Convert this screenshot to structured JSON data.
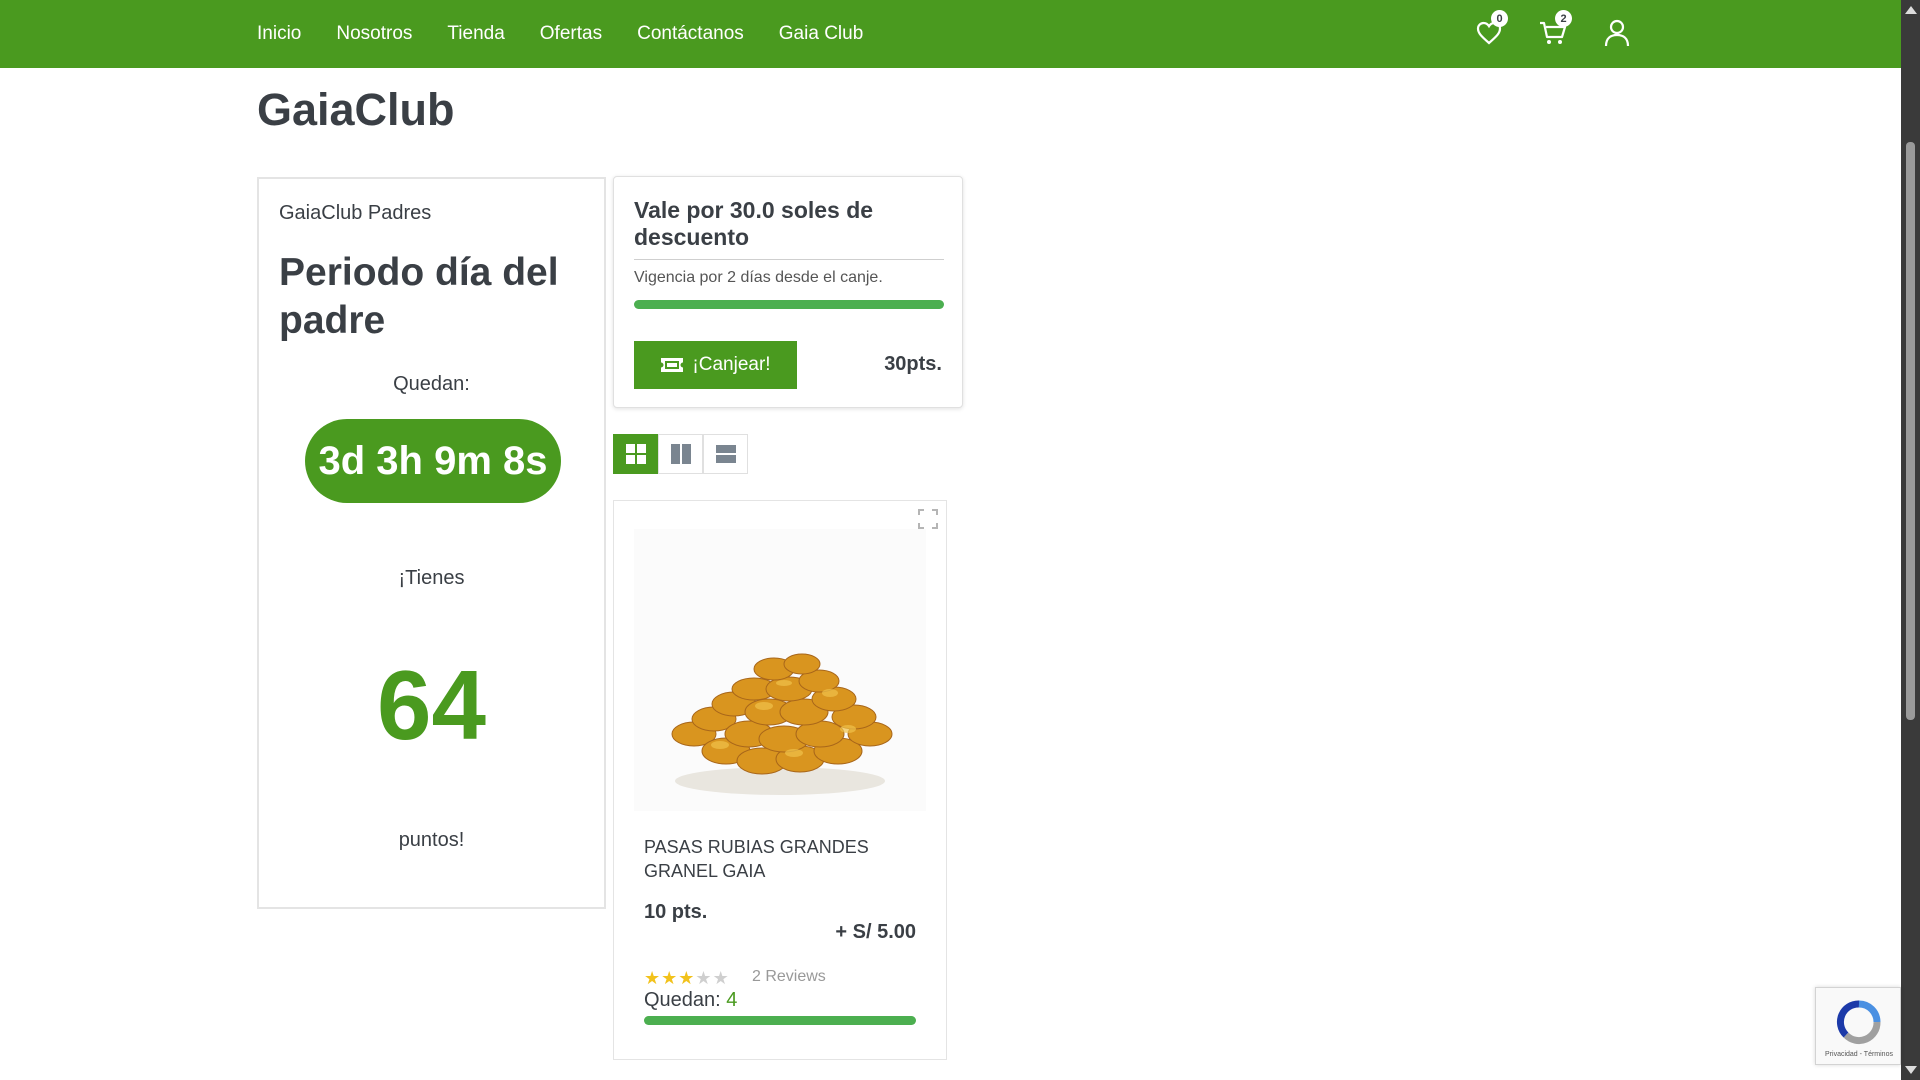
{
  "nav": {
    "items": [
      {
        "label": "Inicio"
      },
      {
        "label": "Nosotros"
      },
      {
        "label": "Tienda"
      },
      {
        "label": "Ofertas"
      },
      {
        "label": "Contáctanos"
      },
      {
        "label": "Gaia Club"
      }
    ],
    "wishlist_count": "0",
    "cart_count": "2",
    "icons": [
      "heart-icon",
      "cart-icon",
      "user-icon"
    ]
  },
  "page": {
    "title": "GaiaClub"
  },
  "club": {
    "name": "GaiaClub Padres",
    "period": "Periodo día del padre",
    "remaining_label": "Quedan:",
    "countdown": "3d 3h 9m 8s",
    "have_label": "¡Tienes",
    "points": "64",
    "points_label": "puntos!"
  },
  "voucher": {
    "title": "Vale por 30.0 soles de descuento",
    "validity": "Vigencia por 2 días desde el canje.",
    "progress": 1.0,
    "redeem_label": "¡Canjear!",
    "cost": "30pts."
  },
  "views": {
    "active": "grid"
  },
  "product": {
    "name": "PASAS RUBIAS GRANDES GRANEL GAIA",
    "points": "10 pts.",
    "price": "+ S/ 5.00",
    "rating": 3,
    "rating_max": 5,
    "reviews": "2 Reviews",
    "stock_label": "Quedan:",
    "stock": "4",
    "stock_fraction": 1.0
  },
  "recaptcha": {
    "text": "Privacidad - Términos"
  },
  "colors": {
    "brand": "#4a9a1f",
    "bar": "#4caf50",
    "star": "#f2c21b"
  }
}
